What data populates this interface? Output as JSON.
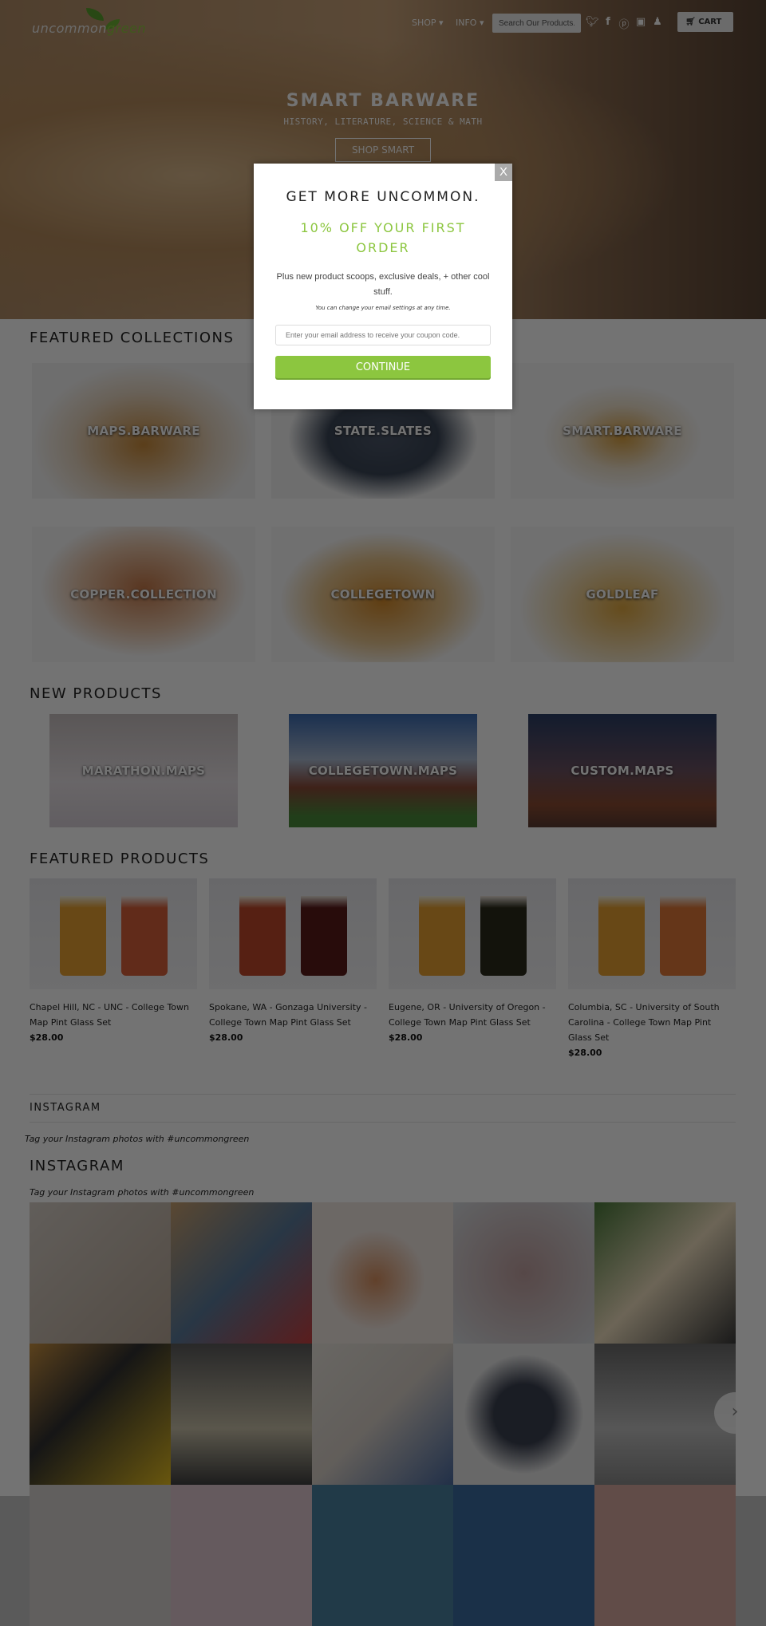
{
  "header": {
    "logo_a": "uncommon",
    "logo_b": "green",
    "nav": [
      {
        "label": "SHOP ▾"
      },
      {
        "label": "INFO ▾"
      }
    ],
    "search_placeholder": "Search Our Products...",
    "social": [
      "twitter-icon",
      "facebook-icon",
      "pinterest-icon",
      "instagram-icon",
      "user-icon"
    ],
    "cart_label": "CART"
  },
  "hero": {
    "title": "SMART BARWARE",
    "subtitle": "HISTORY, LITERATURE, SCIENCE & MATH",
    "button": "SHOP SMART"
  },
  "featured_collections": {
    "title": "FEATURED COLLECTIONS",
    "items": [
      {
        "label": "MAPS.BARWARE"
      },
      {
        "label": "STATE.SLATES"
      },
      {
        "label": "SMART.BARWARE"
      },
      {
        "label": "COPPER.COLLECTION"
      },
      {
        "label": "COLLEGETOWN"
      },
      {
        "label": "GOLDLEAF"
      }
    ]
  },
  "new_products": {
    "title": "NEW PRODUCTS",
    "items": [
      {
        "label": "MARATHON.MAPS"
      },
      {
        "label": "COLLEGETOWN.MAPS"
      },
      {
        "label": "CUSTOM.MAPS"
      }
    ]
  },
  "featured_products": {
    "title": "FEATURED PRODUCTS",
    "items": [
      {
        "title": "Chapel Hill, NC - UNC - College Town Map Pint Glass Set",
        "price": "$28.00"
      },
      {
        "title": "Spokane, WA - Gonzaga University - College Town Map Pint Glass Set",
        "price": "$28.00"
      },
      {
        "title": "Eugene, OR - University of Oregon - College Town Map Pint Glass Set",
        "price": "$28.00"
      },
      {
        "title": "Columbia, SC - University of South Carolina - College Town Map Pint Glass Set",
        "price": "$28.00"
      }
    ]
  },
  "instagram": {
    "title_small": "INSTAGRAM",
    "tag1": "Tag your Instagram photos with #uncommongreen",
    "title_large": "INSTAGRAM",
    "tag2": "Tag your Instagram photos with #uncommongreen"
  },
  "modal": {
    "close": "X",
    "title": "GET MORE UNCOMMON.",
    "offer": "10% OFF YOUR FIRST ORDER",
    "body": "Plus new product scoops, exclusive deals, + other cool stuff.",
    "note": "You can change your email settings at any time.",
    "email_placeholder": "Enter your email address to receive your coupon code.",
    "button": "CONTINUE"
  },
  "colors": {
    "accent": "#8cc63f"
  }
}
